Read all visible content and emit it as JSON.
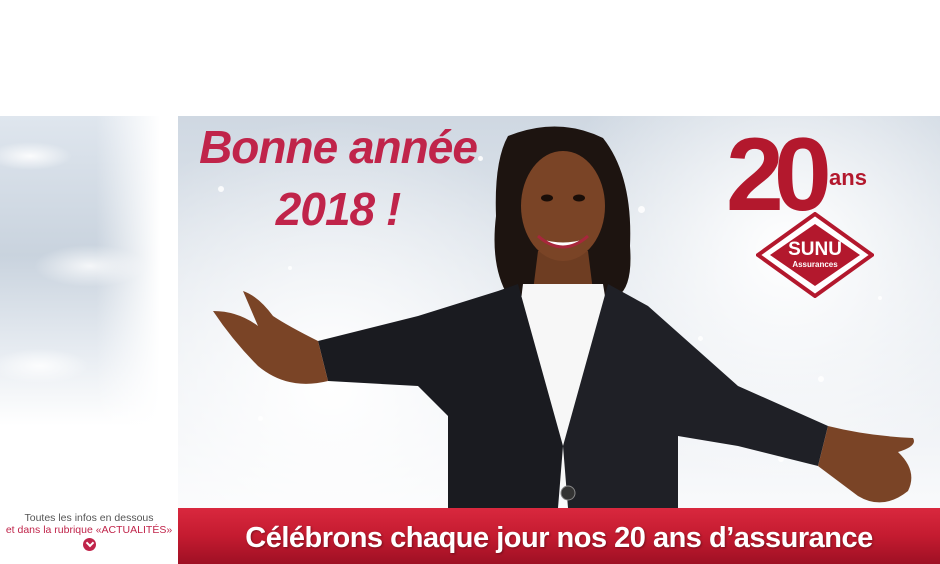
{
  "banner": {
    "headline_line1": "Bonne année",
    "headline_line2": "2018 !",
    "ribbon_text": "Célébrons chaque jour nos 20 ans  d’assurance"
  },
  "logo": {
    "number": "20",
    "ans": "ans",
    "brand": "SUNU",
    "tagline": "Assurances"
  },
  "info": {
    "line1": "Toutes les infos en dessous",
    "line2": "et dans la rubrique «ACTUALITÉS»",
    "icon": "chevron-down-icon"
  },
  "colors": {
    "brand_red": "#c0244a",
    "ribbon_red": "#c41b30"
  }
}
